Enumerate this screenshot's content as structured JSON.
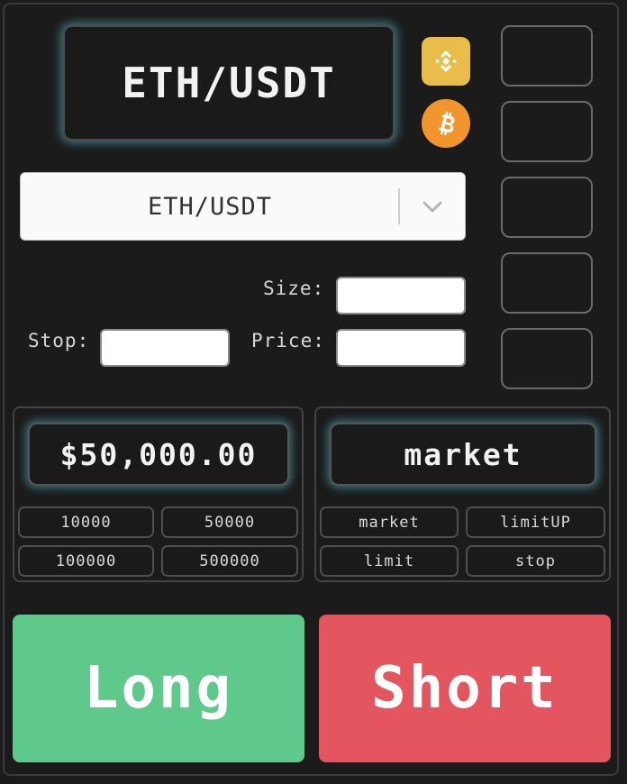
{
  "header": {
    "pair_display": "ETH/USDT"
  },
  "exchanges": [
    {
      "icon": "binance-icon",
      "color": "#e9bd4a"
    },
    {
      "icon": "bitcoin-icon",
      "color": "#f0962c"
    }
  ],
  "symbol_select": {
    "selected": "ETH/USDT"
  },
  "form": {
    "size_label": "Size:",
    "stop_label": "Stop:",
    "price_label": "Price:"
  },
  "amount": {
    "display": "$50,000.00",
    "presets": [
      "10000",
      "50000",
      "100000",
      "500000"
    ]
  },
  "order_type": {
    "display": "market",
    "options": [
      "market",
      "limitUP",
      "limit",
      "stop"
    ]
  },
  "actions": {
    "long": "Long",
    "short": "Short"
  },
  "colors": {
    "accent_glow": "#5abecd",
    "long": "#5ec98a",
    "short": "#e3555f"
  }
}
